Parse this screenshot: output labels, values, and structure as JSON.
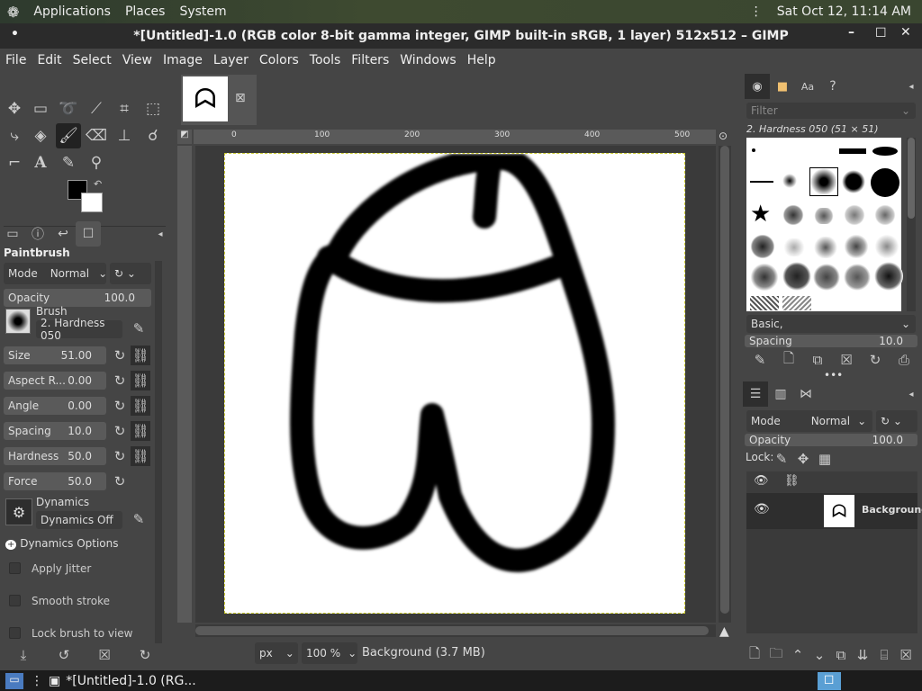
{
  "topbar": {
    "applications": "Applications",
    "places": "Places",
    "system": "System",
    "datetime": "Sat Oct 12, 11:14 AM"
  },
  "window": {
    "title": "*[Untitled]-1.0 (RGB color 8-bit gamma integer, GIMP built-in sRGB, 1 layer) 512x512 – GIMP"
  },
  "menu": [
    "File",
    "Edit",
    "Select",
    "View",
    "Image",
    "Layer",
    "Colors",
    "Tools",
    "Filters",
    "Windows",
    "Help"
  ],
  "tool_options": {
    "title": "Paintbrush",
    "mode_label": "Mode",
    "mode_value": "Normal",
    "opacity_label": "Opacity",
    "opacity_value": "100.0",
    "brush_label": "Brush",
    "brush_value": "2. Hardness 050",
    "size_label": "Size",
    "size_value": "51.00",
    "aspect_label": "Aspect R...",
    "aspect_value": "0.00",
    "angle_label": "Angle",
    "angle_value": "0.00",
    "spacing_label": "Spacing",
    "spacing_value": "10.0",
    "hardness_label": "Hardness",
    "hardness_value": "50.0",
    "force_label": "Force",
    "force_value": "50.0",
    "dynamics_label": "Dynamics",
    "dynamics_value": "Dynamics Off",
    "dynamics_options": "Dynamics Options",
    "apply_jitter": "Apply Jitter",
    "smooth_stroke": "Smooth stroke",
    "lock_brush": "Lock brush to view"
  },
  "ruler": {
    "marks": [
      "0",
      "100",
      "200",
      "300",
      "400",
      "500"
    ]
  },
  "status": {
    "unit": "px",
    "zoom": "100 %",
    "layer_info": "Background (3.7 MB)"
  },
  "brushes": {
    "filter_placeholder": "Filter",
    "selected": "2. Hardness 050 (51 × 51)",
    "tag": "Basic,",
    "spacing_label": "Spacing",
    "spacing_value": "10.0"
  },
  "layers": {
    "mode_label": "Mode",
    "mode_value": "Normal",
    "opacity_label": "Opacity",
    "opacity_value": "100.0",
    "lock_label": "Lock:",
    "layer_name": "Background"
  },
  "taskbar": {
    "window": "*[Untitled]-1.0 (RG..."
  }
}
